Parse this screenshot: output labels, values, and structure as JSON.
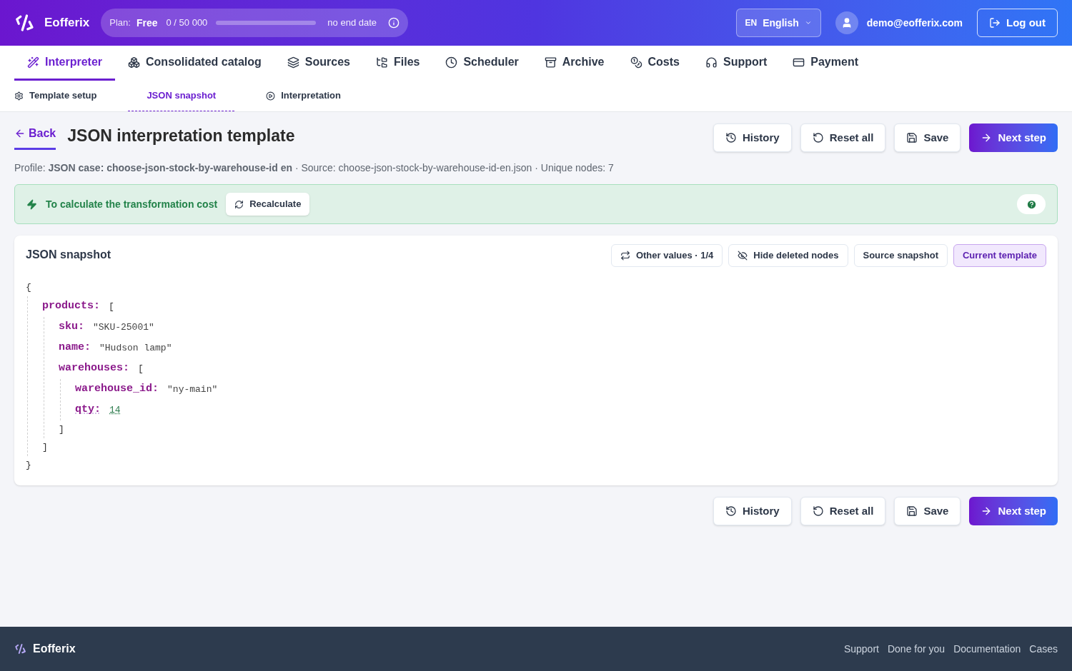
{
  "header": {
    "brand": "Eofferix",
    "plan": {
      "label": "Plan:",
      "name": "Free",
      "usage": "0 / 50 000",
      "level": 0,
      "end": "no end date"
    },
    "language": {
      "code": "EN",
      "name": "English"
    },
    "user": "demo@eofferix.com",
    "logout": "Log out"
  },
  "nav": [
    {
      "label": "Interpreter",
      "selected": true
    },
    {
      "label": "Consolidated catalog",
      "selected": false
    },
    {
      "label": "Sources",
      "selected": false
    },
    {
      "label": "Files",
      "selected": false
    },
    {
      "label": "Scheduler",
      "selected": false
    },
    {
      "label": "Archive",
      "selected": false
    },
    {
      "label": "Costs",
      "selected": false
    },
    {
      "label": "Support",
      "selected": false
    },
    {
      "label": "Payment",
      "selected": false
    }
  ],
  "subtabs": [
    {
      "label": "Template setup",
      "selected": false
    },
    {
      "label": "JSON snapshot",
      "selected": true
    },
    {
      "label": "Interpretation",
      "selected": false
    }
  ],
  "page": {
    "back": "Back",
    "title": "JSON interpretation template",
    "meta": "Profile: **JSON case: choose-json-stock-by-warehouse-id en** · Source: choose-json-stock-by-warehouse-id-en.json · Unique nodes: 7"
  },
  "actions": [
    {
      "label": "History",
      "kind": "secondary"
    },
    {
      "label": "Reset all",
      "kind": "secondary"
    },
    {
      "label": "Save",
      "kind": "secondary"
    },
    {
      "label": "Next step",
      "kind": "primary"
    }
  ],
  "notice": {
    "text": "To calculate the transformation cost",
    "button": "Recalculate"
  },
  "snapshot": {
    "title": "JSON snapshot",
    "tools": [
      {
        "label": "Other values · 1/4",
        "selected": false
      },
      {
        "label": "Hide deleted nodes",
        "selected": false
      },
      {
        "label": "Source snapshot",
        "selected": false
      },
      {
        "label": "Current template",
        "selected": true
      }
    ],
    "tree": {
      "open": "{",
      "close": "}",
      "children": [
        {
          "key": "products:",
          "open": "[",
          "close": "]",
          "children": [
            {
              "key": "sku:",
              "value": "\"SKU-25001\"",
              "kind": "string"
            },
            {
              "key": "name:",
              "value": "\"Hudson lamp\"",
              "kind": "string"
            },
            {
              "key": "warehouses:",
              "open": "[",
              "close": "]",
              "children": [
                {
                  "key": "warehouse_id:",
                  "value": "\"ny-main\"",
                  "kind": "string"
                },
                {
                  "key": "qty:",
                  "value": "14",
                  "kind": "number"
                }
              ]
            }
          ]
        }
      ]
    }
  },
  "bottom_actions": [
    {
      "label": "History",
      "kind": "secondary"
    },
    {
      "label": "Reset all",
      "kind": "secondary"
    },
    {
      "label": "Save",
      "kind": "secondary"
    },
    {
      "label": "Next step",
      "kind": "primary"
    }
  ],
  "footer": {
    "brand": "Eofferix",
    "links": [
      "Support",
      "Done for you",
      "Documentation",
      "Cases"
    ]
  }
}
